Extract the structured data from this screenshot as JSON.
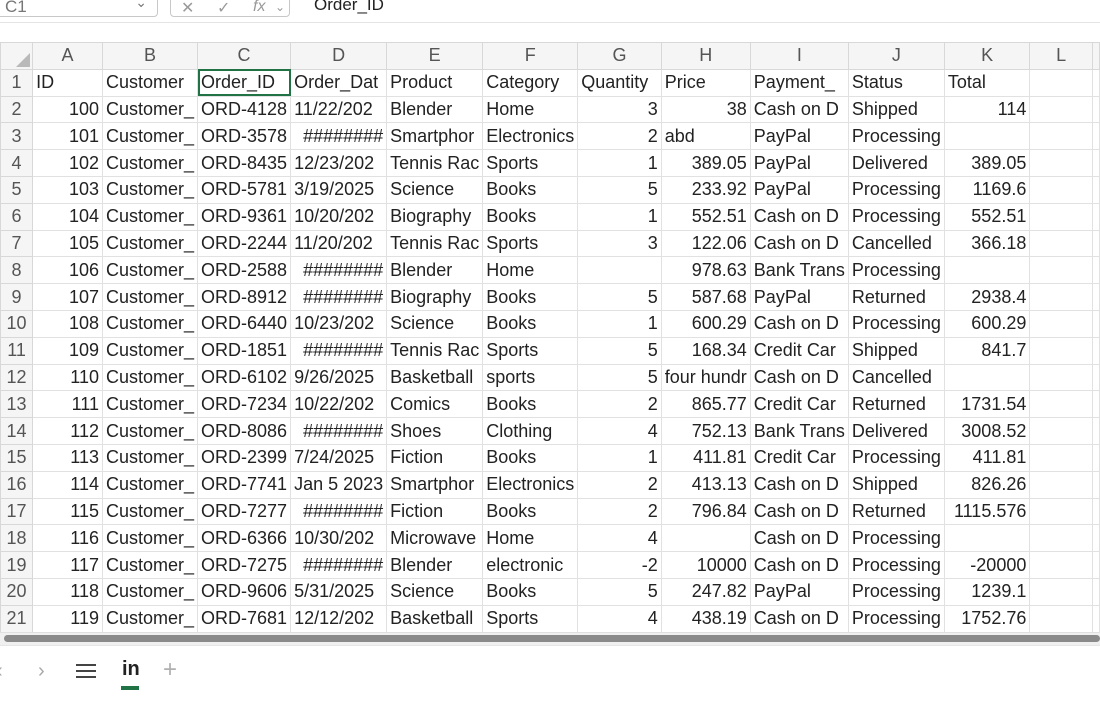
{
  "formula_bar": {
    "name_box": "C1",
    "name_box_caret": "⌄",
    "cancel_icon": "✕",
    "enter_icon": "✓",
    "fx_label": "fx",
    "fx_caret": "⌄",
    "value": "Order_ID"
  },
  "columns": [
    "A",
    "B",
    "C",
    "D",
    "E",
    "F",
    "G",
    "H",
    "I",
    "J",
    "K",
    "L"
  ],
  "selected_column": "C",
  "rows": [
    {
      "n": "1",
      "cells": [
        "ID",
        "Customer",
        "Order_ID",
        "Order_Dat",
        "Product",
        "Category",
        "Quantity",
        "Price",
        "Payment_",
        "Status",
        "Total",
        ""
      ]
    },
    {
      "n": "2",
      "cells": [
        "100",
        "Customer_",
        "ORD-4128",
        "11/22/202",
        "Blender",
        "Home",
        "3",
        "38",
        "Cash on D",
        "Shipped",
        "114",
        ""
      ]
    },
    {
      "n": "3",
      "cells": [
        "101",
        "Customer_",
        "ORD-3578",
        "########",
        "Smartphor",
        "Electronics",
        "2",
        "abd",
        "PayPal",
        "Processing",
        "",
        ""
      ]
    },
    {
      "n": "4",
      "cells": [
        "102",
        "Customer_",
        "ORD-8435",
        "12/23/202",
        "Tennis Rac",
        "Sports",
        "1",
        "389.05",
        "PayPal",
        "Delivered",
        "389.05",
        ""
      ]
    },
    {
      "n": "5",
      "cells": [
        "103",
        "Customer_",
        "ORD-5781",
        "3/19/2025",
        "Science",
        "Books",
        "5",
        "233.92",
        "PayPal",
        "Processing",
        "1169.6",
        ""
      ]
    },
    {
      "n": "6",
      "cells": [
        "104",
        "Customer_",
        "ORD-9361",
        "10/20/202",
        "Biography",
        "Books",
        "1",
        "552.51",
        "Cash on D",
        "Processing",
        "552.51",
        ""
      ]
    },
    {
      "n": "7",
      "cells": [
        "105",
        "Customer_",
        "ORD-2244",
        "11/20/202",
        "Tennis Rac",
        "Sports",
        "3",
        "122.06",
        "Cash on D",
        "Cancelled",
        "366.18",
        ""
      ]
    },
    {
      "n": "8",
      "cells": [
        "106",
        "Customer_",
        "ORD-2588",
        "########",
        "Blender",
        "Home",
        "",
        "978.63",
        "Bank Trans",
        "Processing",
        "",
        ""
      ]
    },
    {
      "n": "9",
      "cells": [
        "107",
        "Customer_",
        "ORD-8912",
        "########",
        "Biography",
        "Books",
        "5",
        "587.68",
        "PayPal",
        "Returned",
        "2938.4",
        ""
      ]
    },
    {
      "n": "10",
      "cells": [
        "108",
        "Customer_",
        "ORD-6440",
        "10/23/202",
        "Science",
        "Books",
        "1",
        "600.29",
        "Cash on D",
        "Processing",
        "600.29",
        ""
      ]
    },
    {
      "n": "11",
      "cells": [
        "109",
        "Customer_",
        "ORD-1851",
        "########",
        "Tennis Rac",
        "Sports",
        "5",
        "168.34",
        "Credit Car",
        "Shipped",
        "841.7",
        ""
      ]
    },
    {
      "n": "12",
      "cells": [
        "110",
        "Customer_",
        "ORD-6102",
        "9/26/2025",
        "Basketball",
        "sports",
        "5",
        "four hundr",
        "Cash on D",
        "Cancelled",
        "",
        ""
      ]
    },
    {
      "n": "13",
      "cells": [
        "111",
        "Customer_",
        "ORD-7234",
        "10/22/202",
        "Comics",
        "Books",
        "2",
        "865.77",
        "Credit Car",
        "Returned",
        "1731.54",
        ""
      ]
    },
    {
      "n": "14",
      "cells": [
        "112",
        "Customer_",
        "ORD-8086",
        "########",
        "Shoes",
        "Clothing",
        "4",
        "752.13",
        "Bank Trans",
        "Delivered",
        "3008.52",
        ""
      ]
    },
    {
      "n": "15",
      "cells": [
        "113",
        "Customer_",
        "ORD-2399",
        "7/24/2025",
        "Fiction",
        "Books",
        "1",
        "411.81",
        "Credit Car",
        "Processing",
        "411.81",
        ""
      ]
    },
    {
      "n": "16",
      "cells": [
        "114",
        "Customer_",
        "ORD-7741",
        "Jan 5 2023",
        "Smartphor",
        "Electronics",
        "2",
        "413.13",
        "Cash on D",
        "Shipped",
        "826.26",
        ""
      ]
    },
    {
      "n": "17",
      "cells": [
        "115",
        "Customer_",
        "ORD-7277",
        "########",
        "Fiction",
        "Books",
        "2",
        "796.84",
        "Cash on D",
        "Returned",
        "1115.576",
        ""
      ]
    },
    {
      "n": "18",
      "cells": [
        "116",
        "Customer_",
        "ORD-6366",
        "10/30/202",
        "Microwave",
        "Home",
        "4",
        "",
        "Cash on D",
        "Processing",
        "",
        ""
      ]
    },
    {
      "n": "19",
      "cells": [
        "117",
        "Customer_",
        "ORD-7275",
        "########",
        "Blender",
        "electronic",
        "-2",
        "10000",
        "Cash on D",
        "Processing",
        "-20000",
        ""
      ]
    },
    {
      "n": "20",
      "cells": [
        "118",
        "Customer_",
        "ORD-9606",
        "5/31/2025",
        "Science",
        "Books",
        "5",
        "247.82",
        "PayPal",
        "Processing",
        "1239.1",
        ""
      ]
    },
    {
      "n": "21",
      "cells": [
        "119",
        "Customer_",
        "ORD-7681",
        "12/12/202",
        "Basketball",
        "Sports",
        "4",
        "438.19",
        "Cash on D",
        "Processing",
        "1752.76",
        ""
      ]
    }
  ],
  "numeric_columns": [
    0,
    6,
    7,
    10
  ],
  "sheet_tabs": {
    "prev_icon": "‹",
    "next_icon": "›",
    "menu_icon": "hamburger",
    "active_tab": "in",
    "add_icon": "+"
  },
  "colors": {
    "accent": "#217346",
    "header_bg": "#f5f5f5",
    "selected_header_bg": "#d9ece0"
  }
}
